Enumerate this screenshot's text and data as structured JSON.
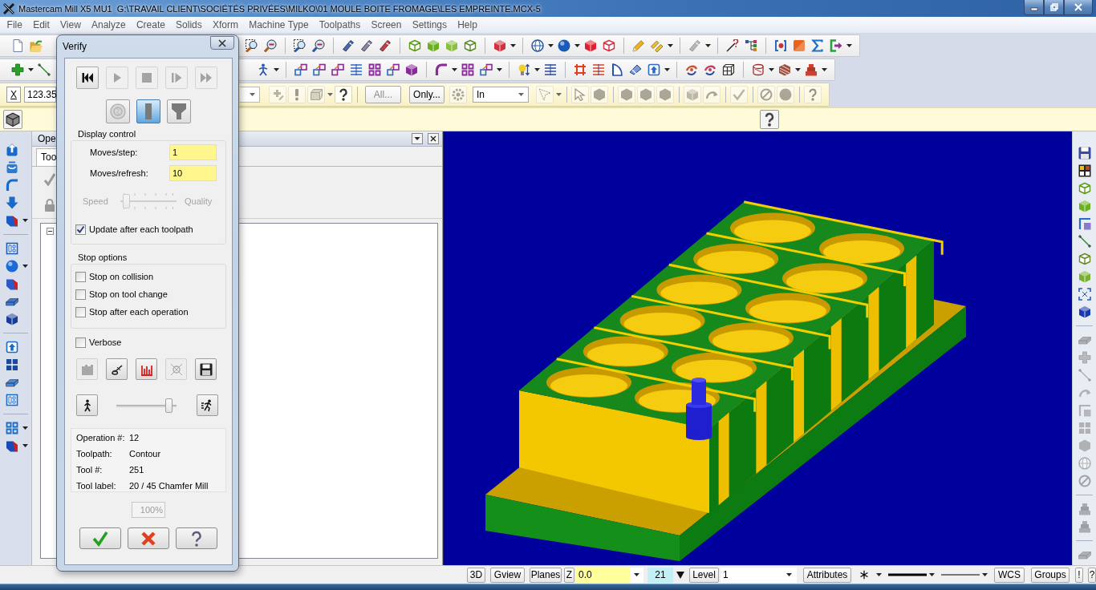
{
  "window": {
    "title": "Mastercam Mill X5 MU1  G:\\TRAVAIL CLIENT\\SOCIÉTÉS PRIVÉES\\MILKO\\01 MOULE BOITE FROMAGE\\LES EMPREINTE.MCX-5"
  },
  "menu": [
    "File",
    "Edit",
    "View",
    "Analyze",
    "Create",
    "Solids",
    "Xform",
    "Machine Type",
    "Toolpaths",
    "Screen",
    "Settings",
    "Help"
  ],
  "toolbar_1": [
    {
      "disabled": false
    },
    {
      "disabled": false
    },
    {
      "disabled": false
    },
    {
      "disabled": false
    },
    {
      "disabled": false
    },
    {
      "disabled": false
    },
    {
      "disabled": false
    },
    {
      "disabled": false
    },
    {
      "disabled": false
    },
    {
      "disabled": false
    },
    {
      "disabled": false
    },
    {
      "disabled": false
    },
    {
      "disabled": false
    },
    {
      "disabled": false
    },
    {
      "disabled": false
    },
    {
      "disabled": false
    },
    {
      "disabled": false
    },
    {
      "disabled": false
    },
    {
      "disabled": false
    },
    {
      "disabled": false
    },
    {
      "disabled": true
    },
    {
      "disabled": false
    },
    {
      "disabled": false
    },
    {
      "disabled": false
    },
    {
      "disabled": false
    },
    {
      "disabled": false
    },
    {
      "disabled": false
    }
  ],
  "toolbar_2": [
    {
      "disabled": false
    },
    {
      "disabled": false
    },
    {
      "disabled": false
    },
    {
      "disabled": false
    },
    {
      "disabled": false
    },
    {
      "disabled": false
    },
    {
      "disabled": false
    },
    {
      "disabled": false
    },
    {
      "disabled": false
    },
    {
      "disabled": false
    },
    {
      "disabled": false
    },
    {
      "disabled": false
    },
    {
      "disabled": false
    },
    {
      "disabled": false
    },
    {
      "disabled": false
    },
    {
      "disabled": false
    },
    {
      "disabled": false
    },
    {
      "disabled": false
    },
    {
      "disabled": false
    },
    {
      "disabled": false
    },
    {
      "disabled": false
    },
    {
      "disabled": false
    },
    {
      "disabled": false
    },
    {
      "disabled": false
    },
    {
      "disabled": false
    },
    {
      "disabled": false
    }
  ],
  "ribbon": {
    "axis_button": "X",
    "coordinate": "123.35",
    "tools": [
      {
        "disabled": true
      },
      {
        "disabled": true
      },
      {
        "disabled": true
      },
      {
        "disabled": false
      },
      {
        "disabled": true
      },
      {
        "disabled": true
      },
      {
        "disabled": true
      },
      {
        "disabled": true
      },
      {
        "disabled": true
      },
      {
        "disabled": true
      },
      {
        "disabled": true
      },
      {
        "disabled": true
      },
      {
        "disabled": true
      },
      {
        "disabled": true
      },
      {
        "disabled": true
      },
      {
        "disabled": true
      },
      {
        "disabled": true
      }
    ],
    "all_button": {
      "label": "All...",
      "disabled": true
    },
    "only_button": {
      "label": "Only...",
      "disabled": false
    },
    "mode": "In"
  },
  "left_toolbar": [
    {
      "disabled": false
    },
    {
      "disabled": false
    },
    {
      "disabled": false
    },
    {
      "disabled": false
    },
    {
      "disabled": false
    },
    {
      "disabled": false
    },
    {
      "disabled": false
    },
    {
      "disabled": false
    },
    {
      "disabled": false
    },
    {
      "disabled": false
    },
    {
      "disabled": false
    },
    {
      "disabled": false
    },
    {
      "disabled": false
    },
    {
      "disabled": false
    },
    {
      "disabled": false
    },
    {
      "disabled": false
    }
  ],
  "operations_panel": {
    "title": "Ope",
    "tab": "Too"
  },
  "right_toolbar": [
    {
      "disabled": false
    },
    {
      "disabled": false
    },
    {
      "disabled": false
    },
    {
      "disabled": false
    },
    {
      "disabled": false
    },
    {
      "disabled": false
    },
    {
      "disabled": false
    },
    {
      "disabled": false
    },
    {
      "disabled": false
    },
    {
      "disabled": false
    },
    {
      "disabled": true
    },
    {
      "disabled": true
    },
    {
      "disabled": true
    },
    {
      "disabled": true
    },
    {
      "disabled": true
    },
    {
      "disabled": true
    },
    {
      "disabled": true
    },
    {
      "disabled": true
    },
    {
      "disabled": true
    },
    {
      "disabled": true
    },
    {
      "disabled": true
    },
    {
      "disabled": true
    }
  ],
  "verify_dialog": {
    "title": "Verify",
    "playback_buttons": [
      {
        "disabled": false
      },
      {
        "disabled": true
      },
      {
        "disabled": true
      },
      {
        "disabled": true
      },
      {
        "disabled": true
      }
    ],
    "display_modes": [
      {
        "selected": false,
        "disabled": true
      },
      {
        "selected": true,
        "disabled": false
      },
      {
        "selected": false,
        "disabled": false
      }
    ],
    "display_control": {
      "title": "Display control",
      "moves_step": {
        "label": "Moves/step:",
        "value": "1"
      },
      "moves_refresh": {
        "label": "Moves/refresh:",
        "value": "10"
      },
      "quality_slider": {
        "left_label": "Speed",
        "right_label": "Quality",
        "disabled": true,
        "level": 0.05
      },
      "update_after_each_toolpath": {
        "label": "Update after each toolpath",
        "checked": true
      }
    },
    "stop_options": {
      "title": "Stop options",
      "items": [
        {
          "label": "Stop on collision",
          "checked": false
        },
        {
          "label": "Stop on tool change",
          "checked": false
        },
        {
          "label": "Stop after each operation",
          "checked": false
        }
      ]
    },
    "verbose": {
      "label": "Verbose",
      "checked": false
    },
    "tool_buttons": [
      {
        "disabled": true
      },
      {
        "disabled": false
      },
      {
        "disabled": false
      },
      {
        "disabled": true
      },
      {
        "disabled": false
      }
    ],
    "speed_slider": {
      "level": 0.92
    },
    "info": [
      {
        "label": "Operation #:",
        "value": "12"
      },
      {
        "label": "Toolpath:",
        "value": "Contour"
      },
      {
        "label": "Tool #:",
        "value": "251"
      },
      {
        "label": "Tool label:",
        "value": "20 / 45 Chamfer Mill"
      }
    ],
    "progress": "100%"
  },
  "status_bar": {
    "view_buttons": [
      "3D",
      "Gview",
      "Planes"
    ],
    "z_label": "Z",
    "z_value": "0.0",
    "color_value": "21",
    "level_button": "Level",
    "level_value": "1",
    "attributes_button": "Attributes",
    "wcs_button": "WCS",
    "groups_button": "Groups",
    "extra_buttons": [
      "!",
      "?"
    ]
  }
}
